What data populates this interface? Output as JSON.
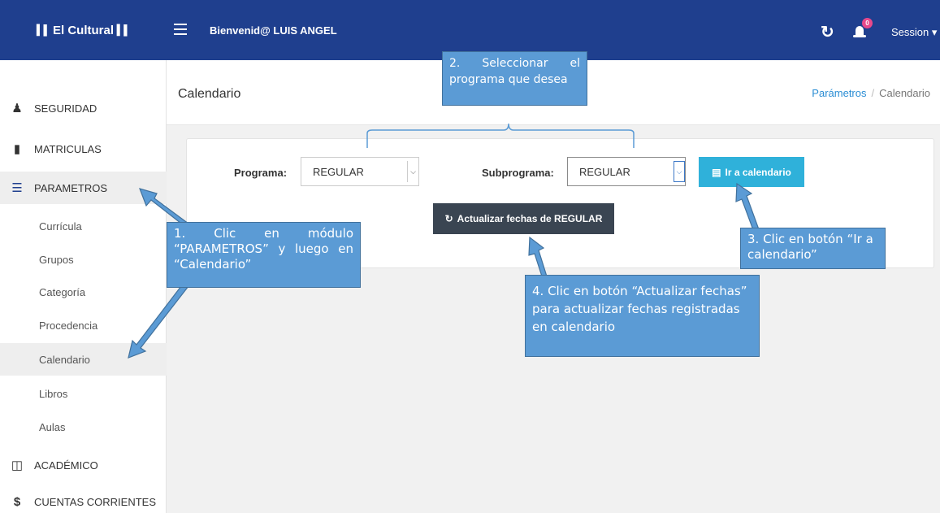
{
  "topbar": {
    "brand": "El Cultural",
    "welcome": "Bienvenid@ LUIS ANGEL",
    "notification_count": "0",
    "session_label": "Session ▾"
  },
  "sidebar": {
    "items": [
      {
        "label": "SEGURIDAD",
        "icon": "user-icon"
      },
      {
        "label": "MATRICULAS",
        "icon": "book-icon"
      },
      {
        "label": "PARAMETROS",
        "icon": "list-icon"
      },
      {
        "label": "ACADÉMICO",
        "icon": "folder-open-icon"
      },
      {
        "label": "CUENTAS CORRIENTES",
        "icon": "dollar-icon"
      }
    ],
    "subitems": [
      "Currícula",
      "Grupos",
      "Categoría",
      "Procedencia",
      "Calendario",
      "Libros",
      "Aulas"
    ]
  },
  "header": {
    "title": "Calendario",
    "breadcrumb": [
      "Parámetros",
      "Calendario"
    ]
  },
  "form": {
    "programa_label": "Programa:",
    "programa_value": "REGULAR",
    "subprograma_label": "Subprograma:",
    "subprograma_value": "REGULAR",
    "calendar_button": "Ir a calendario",
    "update_button": "Actualizar fechas de REGULAR"
  },
  "callouts": {
    "c1": "1. Clic en módulo “PARAMETROS” y luego en “Calendario”",
    "c2": "2. Seleccionar el programa que desea",
    "c3": "3. Clic en botón “Ir a calendario”",
    "c4": "4. Clic en botón “Actualizar fechas” para actualizar fechas registradas en calendario"
  },
  "colors": {
    "topbar": "#1f3f8e",
    "callout": "#5b9bd5",
    "button_info": "#2fb1da",
    "button_dark": "#3a4552"
  }
}
